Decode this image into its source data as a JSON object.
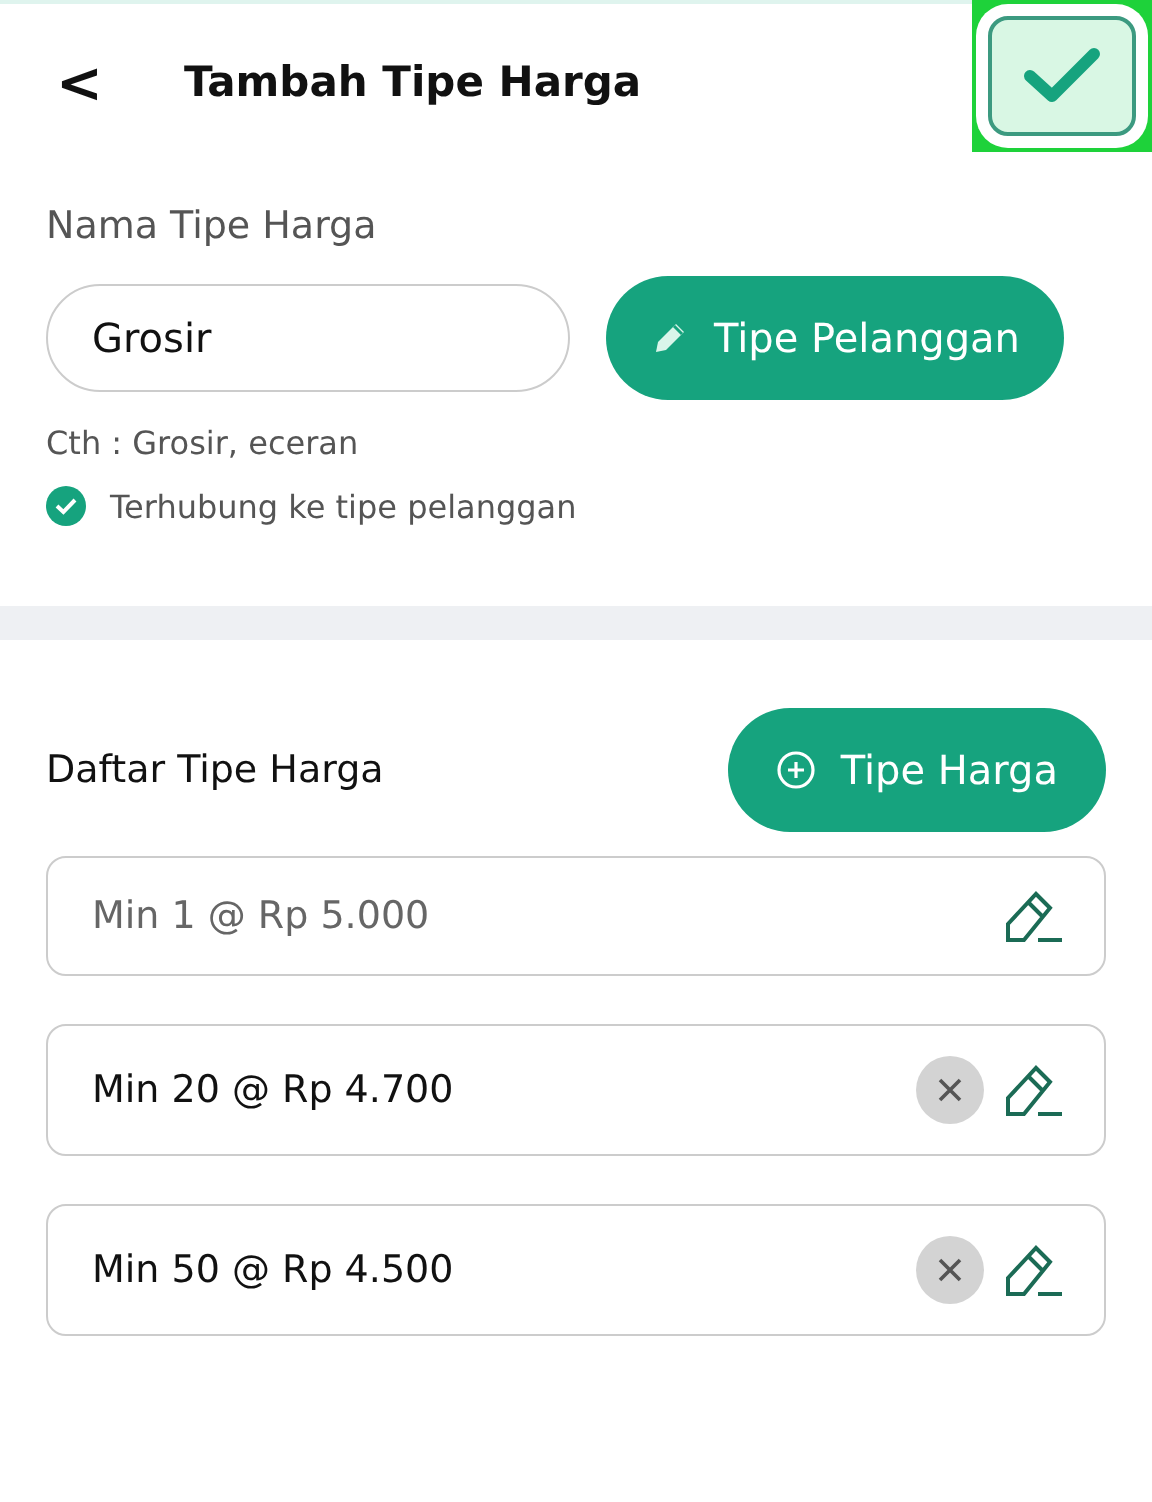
{
  "header": {
    "back_icon": "<",
    "title": "Tambah Tipe Harga",
    "confirm": {
      "highlighted": true
    }
  },
  "name_section": {
    "label": "Nama Tipe Harga",
    "field": {
      "value": "Grosir"
    },
    "customer_type_button": "Tipe Pelanggan",
    "hint": "Cth : Grosir, eceran",
    "linked": {
      "checked": true,
      "text": "Terhubung ke tipe pelanggan"
    }
  },
  "price_list": {
    "title": "Daftar Tipe Harga",
    "add_button": "Tipe Harga",
    "rows": [
      {
        "text": "Min 1 @ Rp 5.000",
        "disabled": true,
        "removable": false
      },
      {
        "text": "Min 20 @ Rp 4.700",
        "disabled": false,
        "removable": true
      },
      {
        "text": "Min 50 @ Rp 4.500",
        "disabled": false,
        "removable": true
      }
    ]
  }
}
